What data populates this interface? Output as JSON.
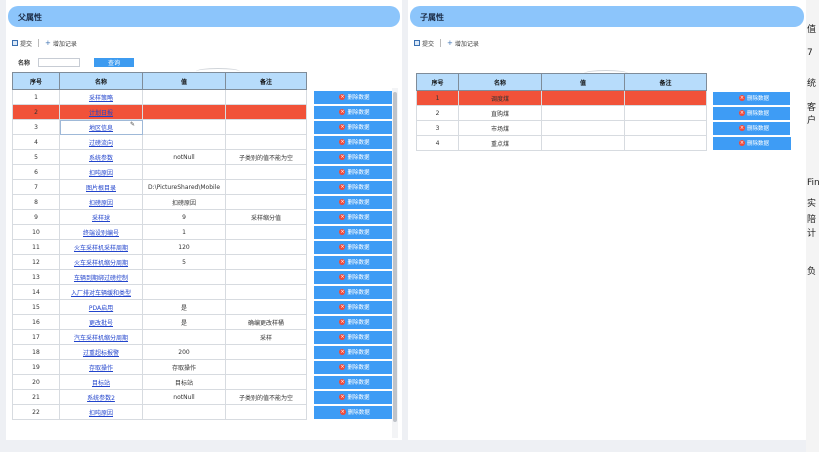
{
  "left": {
    "title": "父属性",
    "toolbar": {
      "submit": "提交",
      "add": "增加记录"
    },
    "search": {
      "label": "名称",
      "value": "",
      "button": "查询"
    },
    "columns": [
      "序号",
      "名称",
      "值",
      "备注"
    ],
    "rows": [
      {
        "no": "1",
        "name": "采样策略",
        "value": "",
        "note": ""
      },
      {
        "no": "2",
        "name": "计划日报",
        "value": "",
        "note": ""
      },
      {
        "no": "3",
        "name": "地区信息",
        "value": "",
        "note": ""
      },
      {
        "no": "4",
        "name": "过磅流向",
        "value": "",
        "note": ""
      },
      {
        "no": "5",
        "name": "系统参数",
        "value": "notNull",
        "note": "子类别的值不能为空"
      },
      {
        "no": "6",
        "name": "扣吨原因",
        "value": "",
        "note": ""
      },
      {
        "no": "7",
        "name": "图片根目录",
        "value": "D:\\PictureShared\\Mobile",
        "note": ""
      },
      {
        "no": "8",
        "name": "扣磅原因",
        "value": "扣磅原因",
        "note": ""
      },
      {
        "no": "9",
        "name": "采样球",
        "value": "9",
        "note": "采样缩分值"
      },
      {
        "no": "10",
        "name": "终端设别编号",
        "value": "1",
        "note": ""
      },
      {
        "no": "11",
        "name": "火车采样机采样周期",
        "value": "120",
        "note": ""
      },
      {
        "no": "12",
        "name": "火车采样机缩分周期",
        "value": "5",
        "note": ""
      },
      {
        "no": "13",
        "name": "车辆到期绑过磅控制",
        "value": "",
        "note": ""
      },
      {
        "no": "14",
        "name": "入厂排对车辆缓和类型",
        "value": "",
        "note": ""
      },
      {
        "no": "15",
        "name": "PDA启用",
        "value": "是",
        "note": ""
      },
      {
        "no": "16",
        "name": "更改批号",
        "value": "是",
        "note": "确编更改样桶"
      },
      {
        "no": "17",
        "name": "汽车采样机缩分周期",
        "value": "",
        "note": "采样"
      },
      {
        "no": "18",
        "name": "过重超标报警",
        "value": "200",
        "note": ""
      },
      {
        "no": "19",
        "name": "存取操作",
        "value": "存取操作",
        "note": ""
      },
      {
        "no": "20",
        "name": "目标站",
        "value": "目标站",
        "note": ""
      },
      {
        "no": "21",
        "name": "系统参数2",
        "value": "notNull",
        "note": "子类别的值不能为空"
      },
      {
        "no": "22",
        "name": "扣吨原因",
        "value": "",
        "note": ""
      }
    ],
    "delete_label": "删除数据"
  },
  "right": {
    "title": "子属性",
    "toolbar": {
      "submit": "提交",
      "add": "增加记录"
    },
    "columns": [
      "序号",
      "名称",
      "值",
      "备注"
    ],
    "rows": [
      {
        "no": "1",
        "name": "调度煤",
        "value": "",
        "note": ""
      },
      {
        "no": "2",
        "name": "直购煤",
        "value": "",
        "note": ""
      },
      {
        "no": "3",
        "name": "市场煤",
        "value": "",
        "note": ""
      },
      {
        "no": "4",
        "name": "重点煤",
        "value": "",
        "note": ""
      }
    ],
    "delete_label": "删除数据"
  },
  "background_chars": [
    "值",
    "7",
    "统",
    "客户",
    "Fin",
    "实",
    "陪",
    "计",
    "负"
  ],
  "colors": {
    "header_bg": "#8cc5fb",
    "selected_row": "#f15239",
    "button_blue": "#3e9cf5",
    "table_header": "#b7dcfb"
  }
}
